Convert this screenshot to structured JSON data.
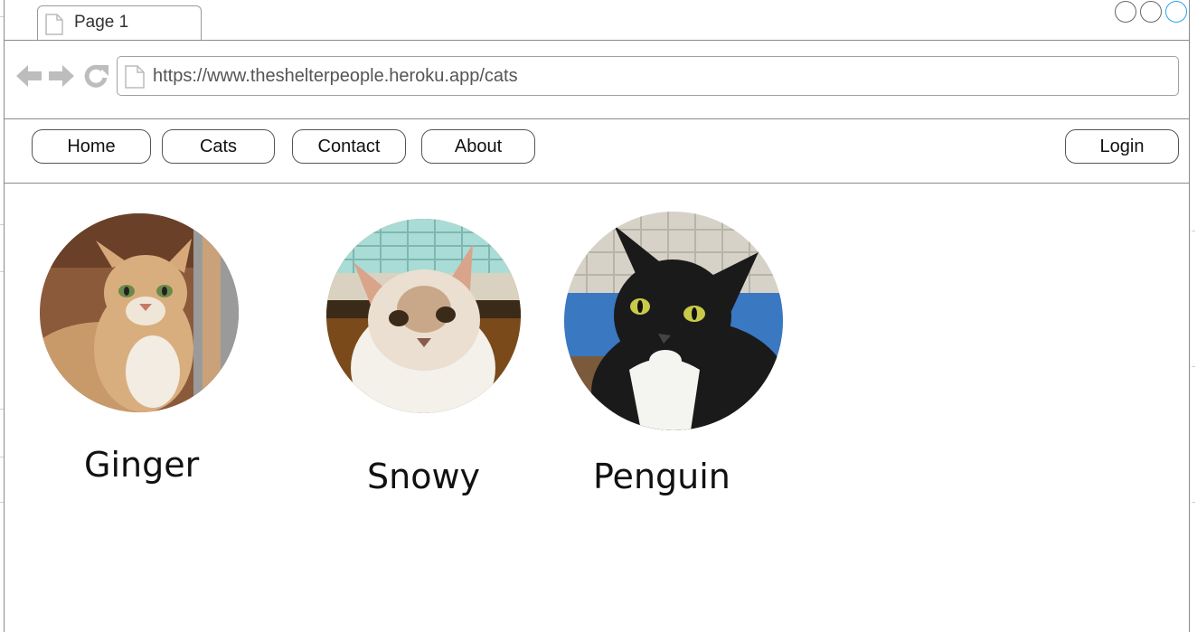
{
  "browser": {
    "tab": {
      "title": "Page 1"
    },
    "address": {
      "url": "https://www.theshelterpeople.heroku.app/cats"
    }
  },
  "nav": {
    "items": [
      {
        "label": "Home"
      },
      {
        "label": "Cats"
      },
      {
        "label": "Contact"
      },
      {
        "label": "About"
      }
    ],
    "login_label": "Login"
  },
  "cats": [
    {
      "name": "Ginger",
      "photo": "ginger-tabby-cat-photo"
    },
    {
      "name": "Snowy",
      "photo": "white-cream-cat-photo"
    },
    {
      "name": "Penguin",
      "photo": "tuxedo-cat-photo"
    }
  ],
  "colors": {
    "active_window_control": "#2aa3e8",
    "border": "#8a8a8a"
  }
}
